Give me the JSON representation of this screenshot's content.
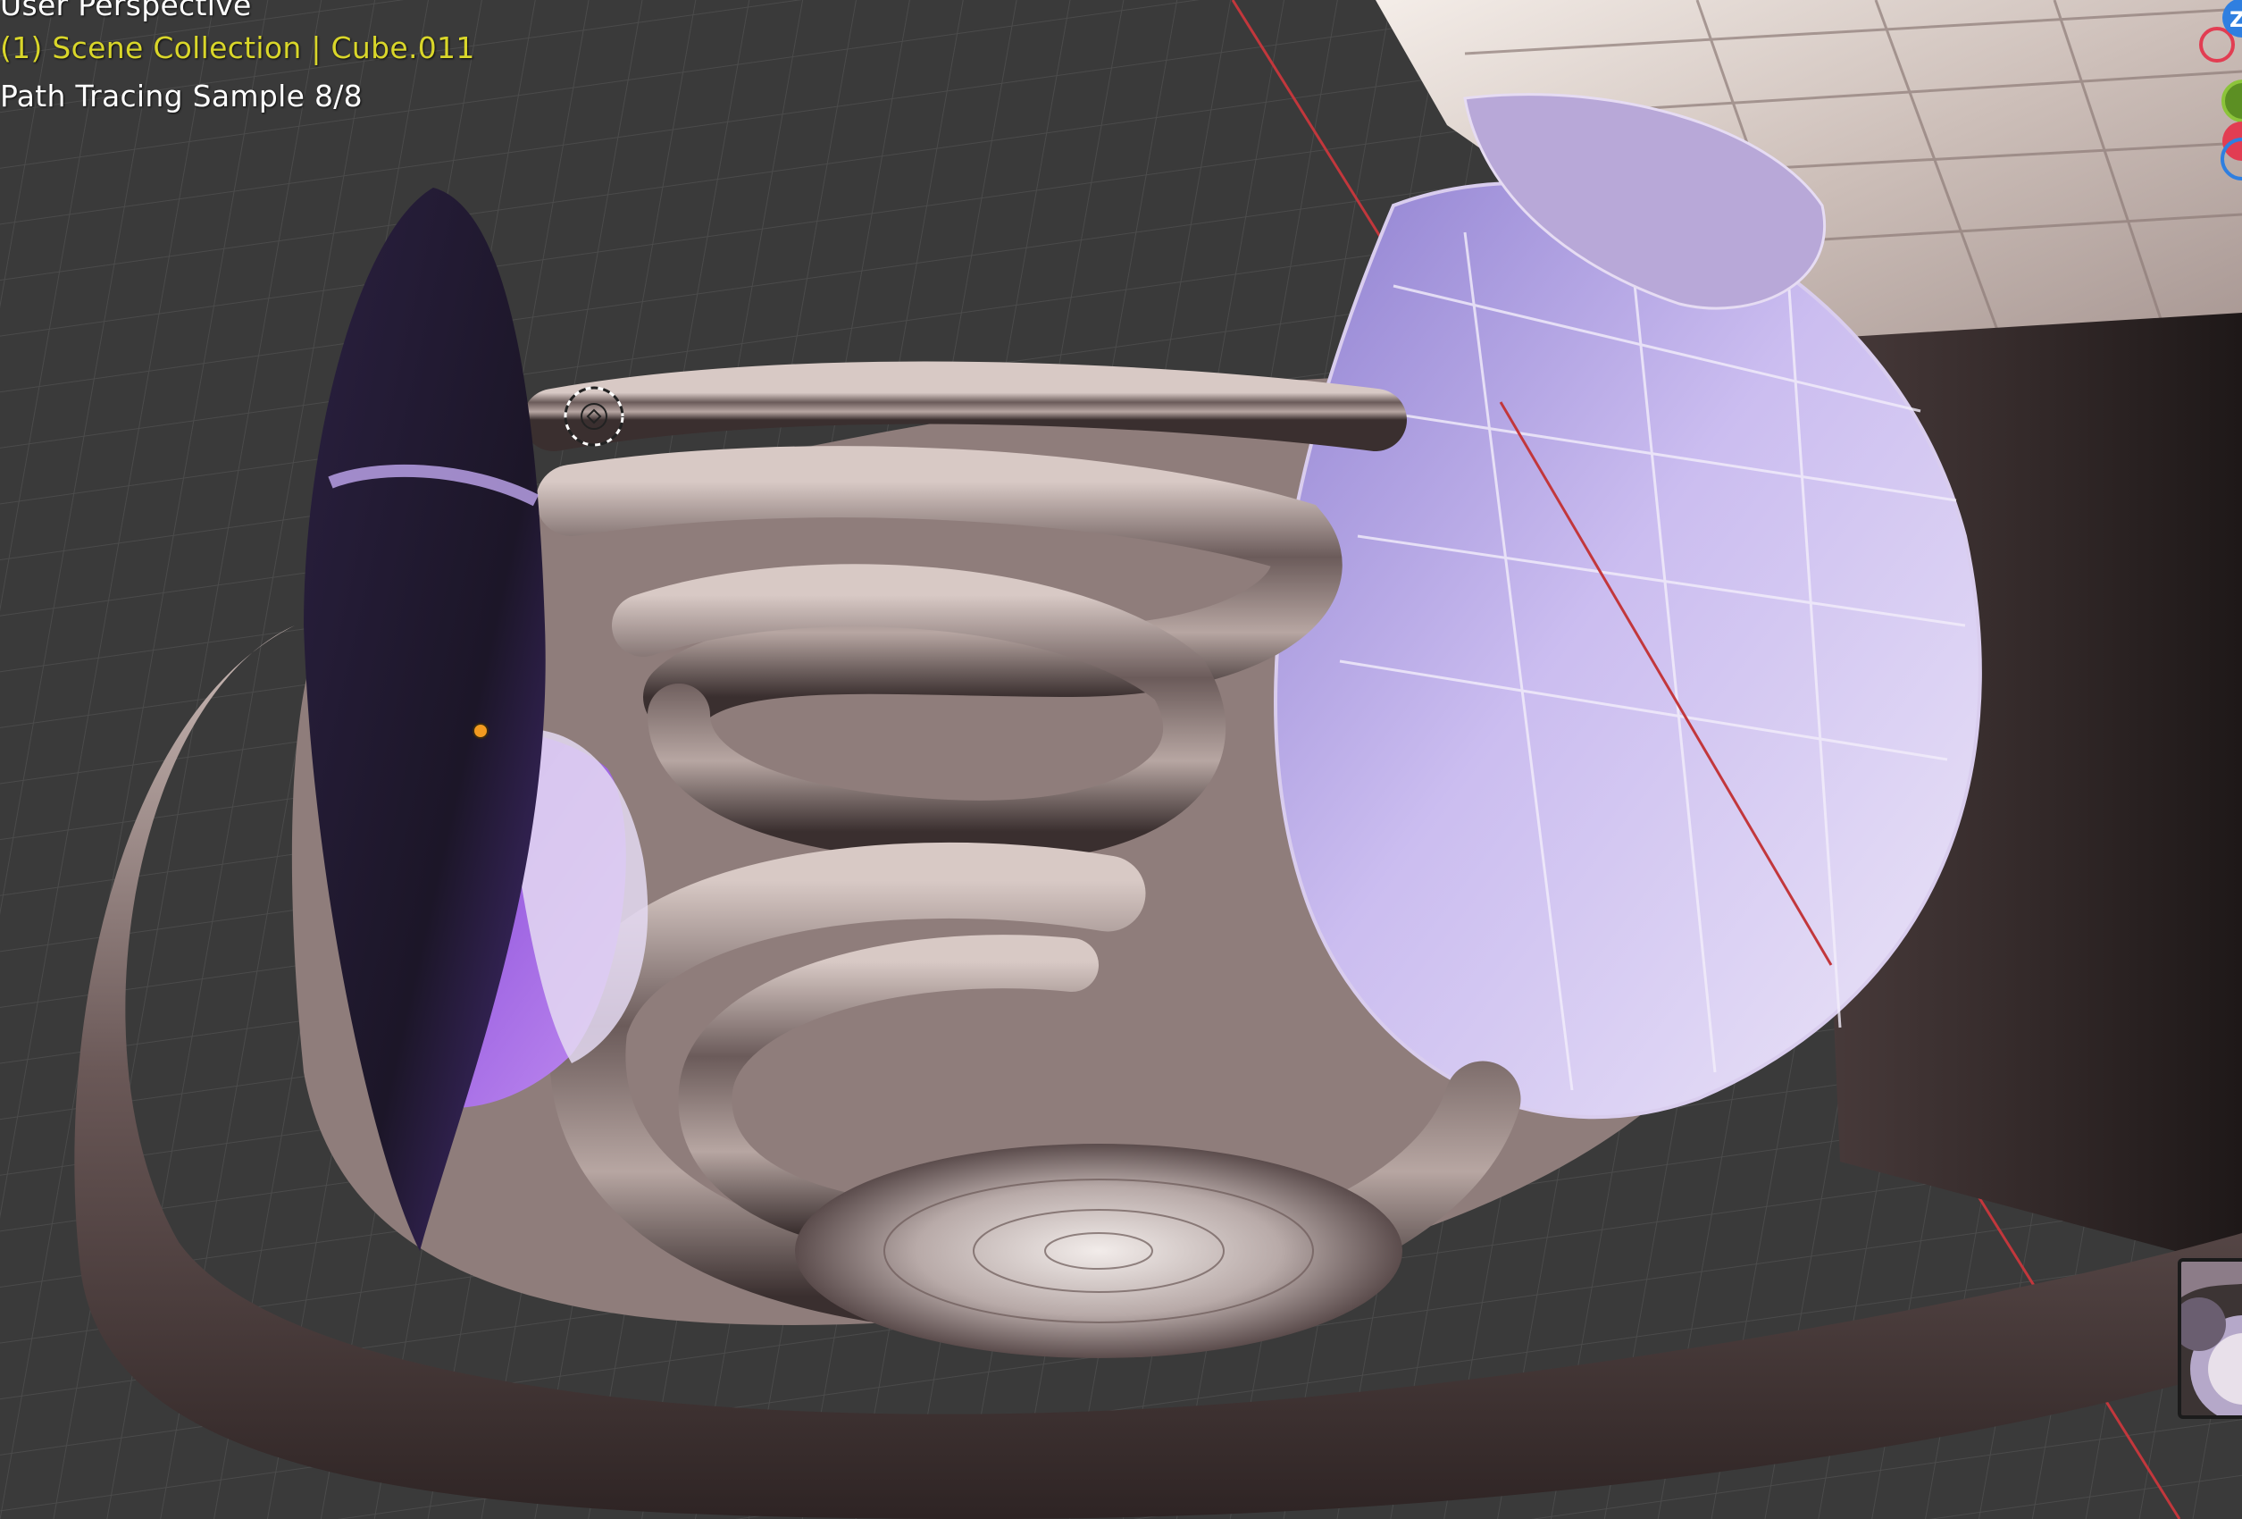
{
  "viewport": {
    "view_name": "User Perspective",
    "collection_line": "(1) Scene Collection | Cube.011",
    "render_status": "Path Tracing Sample 8/8",
    "accent_color": "#d9d62a"
  },
  "navigation_gizmo": {
    "axis_label_z": "Z",
    "colors": {
      "x": "#e23d52",
      "y": "#7db22e",
      "z": "#2f7fe0",
      "origin": "#5c8f23"
    }
  },
  "icons": [
    "3d-cursor-icon",
    "origin-point-icon",
    "gizmo-axis-icon"
  ],
  "colors": {
    "grid_background": "#3a3a3a",
    "grid_line": "#4a4a4a",
    "x_axis_line": "#c2373c",
    "chrome_metal": "#8a7876",
    "glass_violet": "#b9a8e6"
  }
}
